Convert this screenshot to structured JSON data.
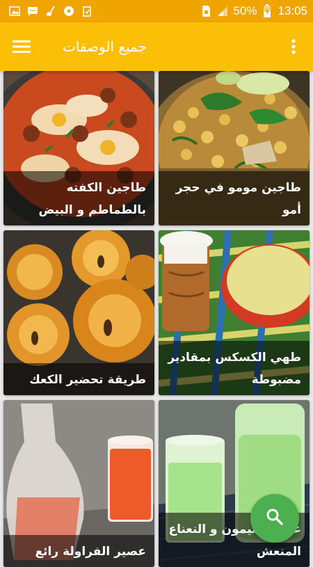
{
  "status_bar": {
    "battery": "50%",
    "time": "13:05",
    "left_icons": [
      "gallery-icon",
      "message-icon",
      "broom-icon",
      "soccer-icon",
      "clipboard-icon"
    ],
    "right_icons": [
      "sim-icon",
      "signal-icon",
      "battery-icon"
    ]
  },
  "app_bar": {
    "title": "جميع الوصفات",
    "menu_icon": "hamburger-menu-icon",
    "more_icon": "more-vertical-icon"
  },
  "recipes": [
    {
      "title": "طاجين مومو في حجر أمو",
      "image": "tagine-chickpeas"
    },
    {
      "title": "طاجين الكفته بالطماطم و البيض",
      "image": "kefta-tomato-egg"
    },
    {
      "title": "طهي الكسكس بمقادير مضبوطة",
      "image": "couscous-milk"
    },
    {
      "title": "طريقة تحضير الكعك",
      "image": "flower-bread"
    },
    {
      "title": "عصير الليمون و النعناع المنعش",
      "image": "green-juice"
    },
    {
      "title": "عصير الفراولة رائع",
      "image": "strawberry-juice"
    }
  ],
  "fab": {
    "icon": "search-icon"
  },
  "colors": {
    "status_bar": "#f0a400",
    "app_bar": "#fcbf07",
    "fab": "#4caf50"
  }
}
